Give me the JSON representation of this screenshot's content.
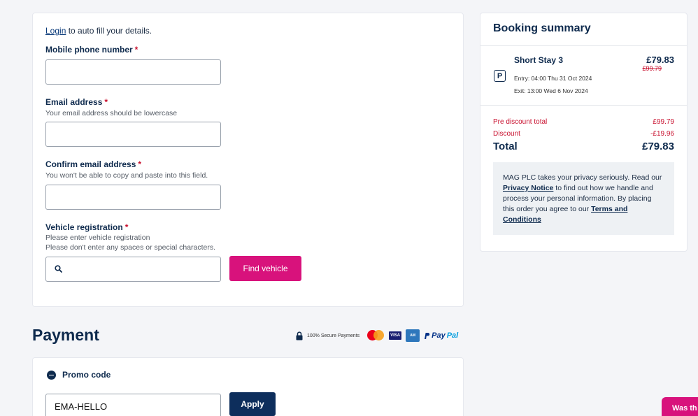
{
  "details": {
    "login_link": "Login",
    "login_suffix": " to auto fill your details.",
    "mobile": {
      "label": "Mobile phone number",
      "required": "*",
      "value": ""
    },
    "email": {
      "label": "Email address",
      "required": "*",
      "hint": "Your email address should be lowercase",
      "value": ""
    },
    "confirm_email": {
      "label": "Confirm email address",
      "required": "*",
      "hint": "You won't be able to copy and paste into this field.",
      "value": ""
    },
    "vehicle": {
      "label": "Vehicle registration",
      "required": "*",
      "hint1": "Please enter vehicle registration",
      "hint2": "Please don't enter any spaces or special characters.",
      "value": "",
      "icon": "search-icon"
    },
    "find_vehicle_button": "Find vehicle"
  },
  "payment": {
    "title": "Payment",
    "secure_text": "100% Secure Payments",
    "lock_icon": "lock-icon",
    "card_logos": {
      "mastercard_text": "mastercard",
      "visa": "VISA",
      "amex": "AMERICAN EXPRESS",
      "paypal_pay": "Pay",
      "paypal_pal": "Pal"
    },
    "promo": {
      "toggle_label": "Promo code",
      "value": "EMA-HELLO",
      "apply_button": "Apply",
      "icon": "minus-circle-icon"
    }
  },
  "summary": {
    "title": "Booking summary",
    "product": {
      "name": "Short Stay 3",
      "icon_letter": "P",
      "price": "£79.83",
      "old_price": "£99.79",
      "entry": "Entry: 04:00 Thu 31 Oct 2024",
      "exit": "Exit: 13:00 Wed 6 Nov 2024"
    },
    "pre_discount": {
      "label": "Pre discount total",
      "value": "£99.79"
    },
    "discount": {
      "label": "Discount",
      "value": "-£19.96"
    },
    "total": {
      "label": "Total",
      "value": "£79.83"
    },
    "privacy": {
      "text1": "MAG PLC takes your privacy seriously. Read our ",
      "privacy_link": "Privacy Notice",
      "text2": " to find out how we handle and process your personal information. By placing this order you agree to our ",
      "terms_link": "Terms and Conditions"
    }
  },
  "feedback_tab": "Was th",
  "colors": {
    "brand_pink": "#d8127c",
    "navy": "#0d2e5c",
    "discount_red": "#c8102e"
  }
}
